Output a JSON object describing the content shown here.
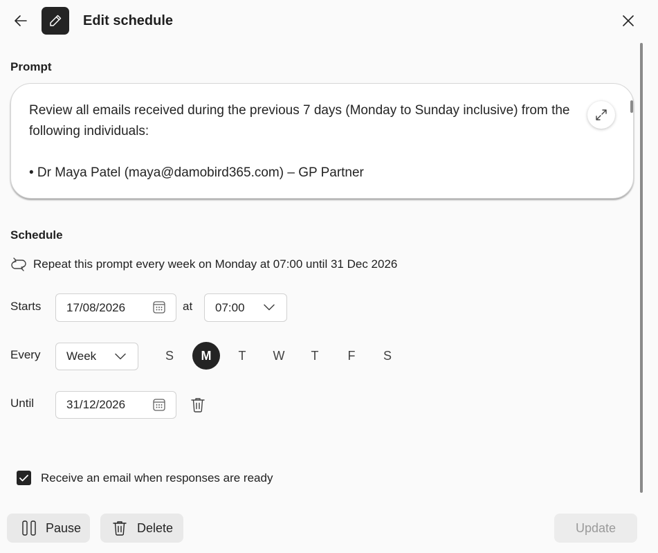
{
  "header": {
    "title": "Edit schedule",
    "back_icon": "arrow-left-icon",
    "app_icon": "pencil-icon",
    "close_icon": "close-icon"
  },
  "prompt": {
    "label": "Prompt",
    "text": "Review all emails received during the previous 7 days (Monday to Sunday inclusive) from the following individuals:\n\n• Dr Maya Patel (maya@damobird365.com) – GP Partner",
    "expand_icon": "expand-icon"
  },
  "schedule": {
    "label": "Schedule",
    "repeat_icon": "repeat-icon",
    "summary": "Repeat this prompt every week on Monday at 07:00 until 31 Dec 2026",
    "starts_label": "Starts",
    "start_date": "17/08/2026",
    "at_label": "at",
    "start_time": "07:00",
    "every_label": "Every",
    "frequency": "Week",
    "days": [
      {
        "label": "S",
        "selected": false
      },
      {
        "label": "M",
        "selected": true
      },
      {
        "label": "T",
        "selected": false
      },
      {
        "label": "W",
        "selected": false
      },
      {
        "label": "T",
        "selected": false
      },
      {
        "label": "F",
        "selected": false
      },
      {
        "label": "S",
        "selected": false
      }
    ],
    "until_label": "Until",
    "until_date": "31/12/2026"
  },
  "email_option": {
    "label": "Receive an email when responses are ready",
    "checked": true
  },
  "footer": {
    "pause_label": "Pause",
    "delete_label": "Delete",
    "update_label": "Update"
  },
  "colors": {
    "background": "#fafafa",
    "accent_dark": "#242424",
    "disabled_text": "#9a9a9a"
  }
}
